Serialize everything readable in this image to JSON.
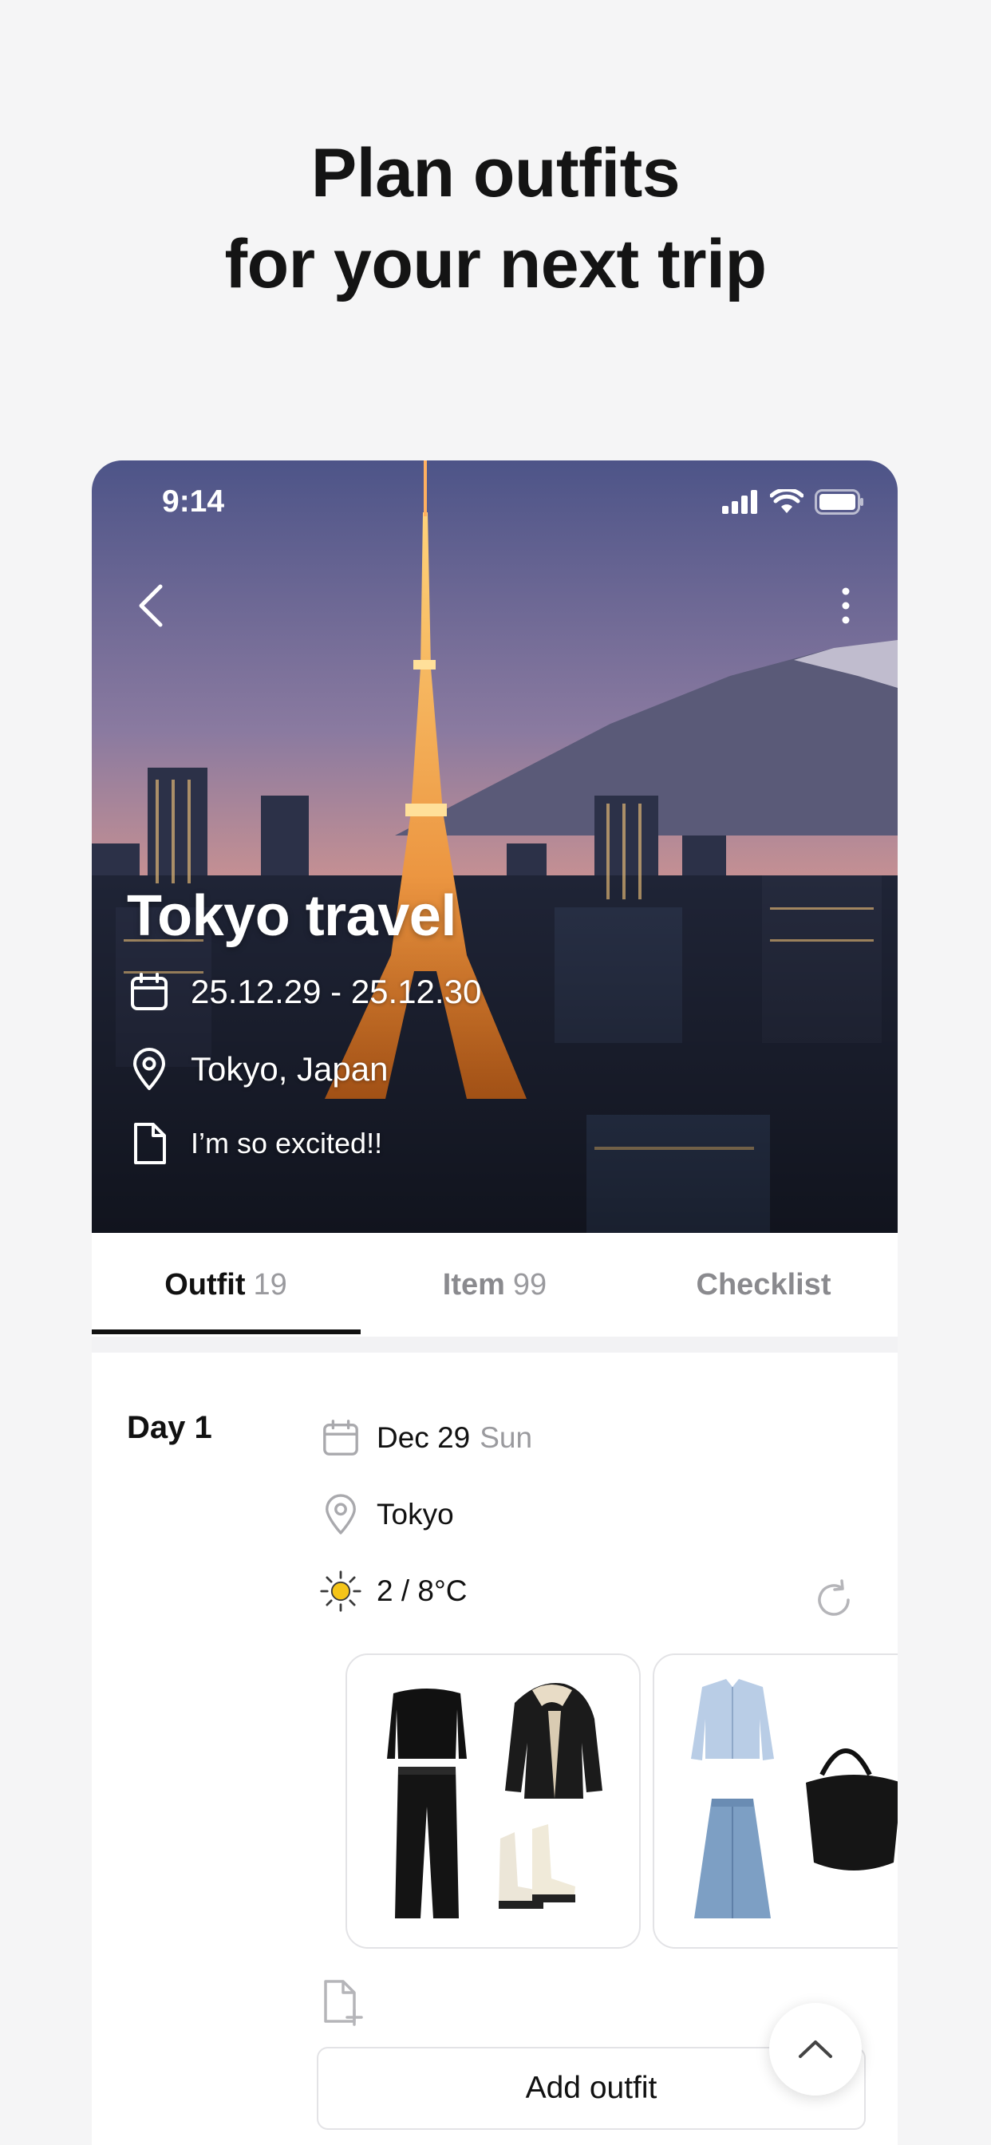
{
  "headline": {
    "line1": "Plan outfits",
    "line2": "for your next trip"
  },
  "status_bar": {
    "time": "9:14",
    "icons": [
      "signal-icon",
      "wifi-icon",
      "battery-icon"
    ]
  },
  "trip": {
    "title": "Tokyo travel",
    "dates": "25.12.29 - 25.12.30",
    "location": "Tokyo, Japan",
    "memo": "I’m so excited!!"
  },
  "tabs": [
    {
      "label": "Outfit",
      "count": "19",
      "active": true
    },
    {
      "label": "Item",
      "count": "99",
      "active": false
    },
    {
      "label": "Checklist",
      "count": "",
      "active": false
    }
  ],
  "day": {
    "label": "Day 1",
    "date": "Dec 29",
    "weekday": "Sun",
    "location": "Tokyo",
    "weather": "2 / 8°C"
  },
  "outfits": [
    {
      "items": [
        "black-top",
        "black-shearling-jacket",
        "black-trousers",
        "cream-chelsea-boots"
      ]
    },
    {
      "items": [
        "light-blue-shirt",
        "denim-skirt",
        "black-hobo-bag"
      ]
    }
  ],
  "actions": {
    "add_outfit": "Add outfit"
  },
  "colors": {
    "accent": "#111111",
    "muted": "#9a9a9e",
    "border": "#e3e3e6",
    "sun": "#f5c518"
  }
}
